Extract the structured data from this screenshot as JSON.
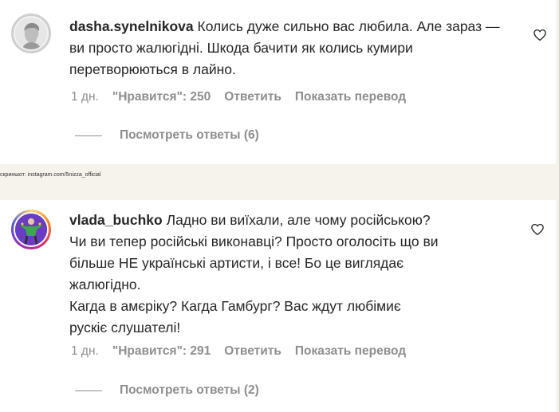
{
  "comments": [
    {
      "username": "dasha.synelnikova",
      "text": "Колись дуже сильно вас любила. Але зараз — ви просто жалюгідні. Шкода бачити як колись кумири перетворюються в лайно.",
      "time": "1 дн.",
      "likes": "\"Нравится\": 250",
      "reply_label": "Ответить",
      "translate_label": "Показать перевод",
      "view_replies": "Посмотреть ответы (6)"
    },
    {
      "username": "vlada_buchko",
      "text_lines": [
        "Ладно ви виїхали, але чому російською?",
        "Чи ви тепер російські виконавці? Просто оголосіть що ви",
        "більше НЕ українські артисти, і все! Бо це виглядає",
        "жалюгідно.",
        "Кагда в амєріку? Кагда Гамбург? Вас ждут любімиє",
        "рускіє слушателі!"
      ],
      "time": "1 дн.",
      "likes": "\"Нравится\": 291",
      "reply_label": "Ответить",
      "translate_label": "Показать перевод",
      "view_replies": "Посмотреть ответы (2)"
    }
  ],
  "caption": "скриншот: instagram.com/5nizza_official",
  "icons": {
    "like": "heart-icon"
  }
}
